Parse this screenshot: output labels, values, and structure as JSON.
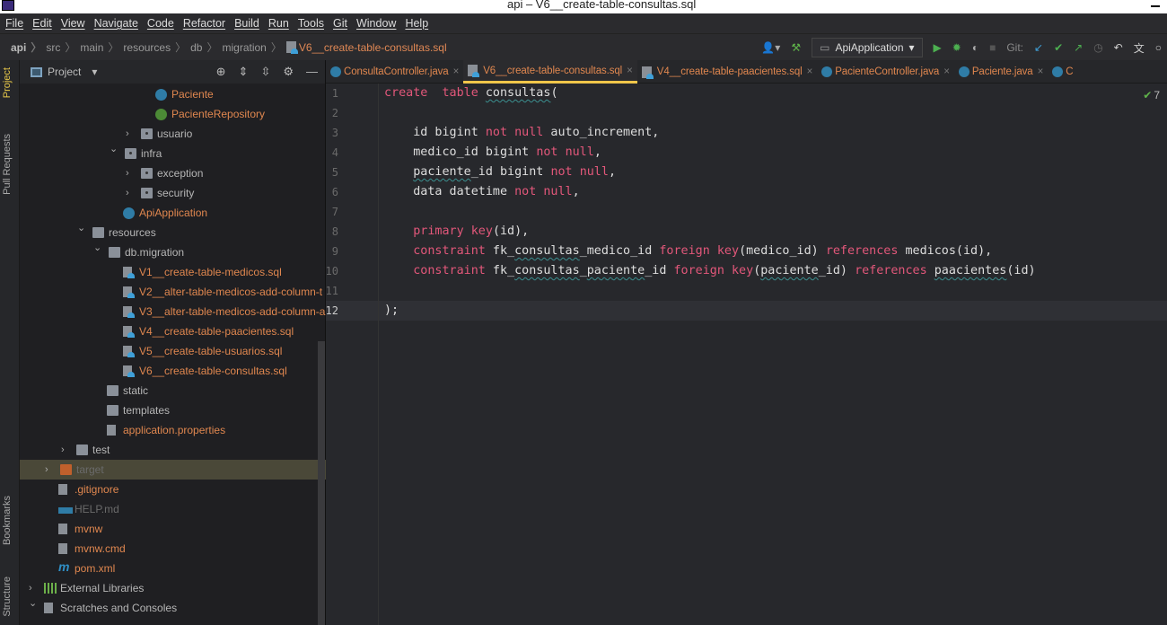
{
  "window": {
    "title": "api – V6__create-table-consultas.sql"
  },
  "menu": [
    "File",
    "Edit",
    "View",
    "Navigate",
    "Code",
    "Refactor",
    "Build",
    "Run",
    "Tools",
    "Git",
    "Window",
    "Help"
  ],
  "breadcrumb": [
    "api",
    "src",
    "main",
    "resources",
    "db",
    "migration",
    "V6__create-table-consultas.sql"
  ],
  "toolbar": {
    "run_config": "ApiApplication",
    "git_label": "Git:"
  },
  "left_stripe": {
    "project": "Project",
    "pull_requests": "Pull Requests",
    "bookmarks": "Bookmarks",
    "structure": "Structure"
  },
  "project_panel": {
    "title": "Project"
  },
  "tree": [
    {
      "label": "Paciente",
      "depth": 7,
      "icon": "class",
      "color": "o"
    },
    {
      "label": "PacienteRepository",
      "depth": 7,
      "icon": "iface",
      "color": "o"
    },
    {
      "label": "usuario",
      "depth": 6,
      "icon": "folder-pkg",
      "arrow": "collapsed",
      "color": "g"
    },
    {
      "label": "infra",
      "depth": 5,
      "icon": "folder-pkg",
      "arrow": "expanded",
      "color": "g"
    },
    {
      "label": "exception",
      "depth": 6,
      "icon": "folder-pkg",
      "arrow": "collapsed",
      "color": "g"
    },
    {
      "label": "security",
      "depth": 6,
      "icon": "folder-pkg",
      "arrow": "collapsed",
      "color": "g"
    },
    {
      "label": "ApiApplication",
      "depth": 5,
      "icon": "class",
      "color": "o"
    },
    {
      "label": "resources",
      "depth": 3,
      "icon": "folder",
      "arrow": "expanded",
      "color": "g"
    },
    {
      "label": "db.migration",
      "depth": 4,
      "icon": "folder",
      "arrow": "expanded",
      "color": "g"
    },
    {
      "label": "V1__create-table-medicos.sql",
      "depth": 5,
      "icon": "sql",
      "color": "o"
    },
    {
      "label": "V2__alter-table-medicos-add-column-t",
      "depth": 5,
      "icon": "sql",
      "color": "o"
    },
    {
      "label": "V3__alter-table-medicos-add-column-a",
      "depth": 5,
      "icon": "sql",
      "color": "o"
    },
    {
      "label": "V4__create-table-paacientes.sql",
      "depth": 5,
      "icon": "sql",
      "color": "o"
    },
    {
      "label": "V5__create-table-usuarios.sql",
      "depth": 5,
      "icon": "sql",
      "color": "o"
    },
    {
      "label": "V6__create-table-consultas.sql",
      "depth": 5,
      "icon": "sql",
      "color": "o"
    },
    {
      "label": "static",
      "depth": 4,
      "icon": "folder",
      "color": "g"
    },
    {
      "label": "templates",
      "depth": 4,
      "icon": "folder",
      "color": "g"
    },
    {
      "label": "application.properties",
      "depth": 4,
      "icon": "file",
      "color": "o"
    },
    {
      "label": "test",
      "depth": 2,
      "icon": "folder",
      "arrow": "collapsed",
      "color": "g"
    },
    {
      "label": "target",
      "depth": 1,
      "icon": "target",
      "arrow": "collapsed",
      "color": "dim",
      "selected": true
    },
    {
      "label": ".gitignore",
      "depth": 1,
      "icon": "file",
      "color": "o"
    },
    {
      "label": "HELP.md",
      "depth": 1,
      "icon": "md",
      "color": "dim"
    },
    {
      "label": "mvnw",
      "depth": 1,
      "icon": "file",
      "color": "o"
    },
    {
      "label": "mvnw.cmd",
      "depth": 1,
      "icon": "file",
      "color": "o"
    },
    {
      "label": "pom.xml",
      "depth": 1,
      "icon": "maven",
      "color": "o"
    },
    {
      "label": "External Libraries",
      "depth": 0,
      "icon": "lib",
      "arrow": "collapsed",
      "color": "g"
    },
    {
      "label": "Scratches and Consoles",
      "depth": 0,
      "icon": "file",
      "arrow": "expanded",
      "color": "g"
    }
  ],
  "tabs": [
    {
      "label": "ConsultaController.java",
      "icon": "class"
    },
    {
      "label": "V6__create-table-consultas.sql",
      "icon": "sql",
      "active": true
    },
    {
      "label": "V4__create-table-paacientes.sql",
      "icon": "sql"
    },
    {
      "label": "PacienteController.java",
      "icon": "class"
    },
    {
      "label": "Paciente.java",
      "icon": "class"
    },
    {
      "label": "C",
      "icon": "class"
    }
  ],
  "editor": {
    "inspection_count": "7",
    "current_line": 12,
    "lines": [
      [
        [
          "kw",
          "create"
        ],
        [
          "",
          "  "
        ],
        [
          "kw",
          "table"
        ],
        [
          "",
          " "
        ],
        [
          "wv",
          "consultas"
        ],
        [
          "",
          "("
        ]
      ],
      [],
      [
        [
          "",
          "    id bigint "
        ],
        [
          "kw",
          "not"
        ],
        [
          "",
          " "
        ],
        [
          "kw",
          "null"
        ],
        [
          "",
          " auto_increment,"
        ]
      ],
      [
        [
          "",
          "    medico_id bigint "
        ],
        [
          "kw",
          "not"
        ],
        [
          "",
          " "
        ],
        [
          "kw",
          "null"
        ],
        [
          "",
          ","
        ]
      ],
      [
        [
          "",
          "    "
        ],
        [
          "wv",
          "paciente"
        ],
        [
          "",
          "_id bigint "
        ],
        [
          "kw",
          "not"
        ],
        [
          "",
          " "
        ],
        [
          "kw",
          "null"
        ],
        [
          "",
          ","
        ]
      ],
      [
        [
          "",
          "    data datetime "
        ],
        [
          "kw",
          "not"
        ],
        [
          "",
          " "
        ],
        [
          "kw",
          "null"
        ],
        [
          "",
          ","
        ]
      ],
      [],
      [
        [
          "",
          "    "
        ],
        [
          "kw",
          "primary"
        ],
        [
          "",
          " "
        ],
        [
          "kw",
          "key"
        ],
        [
          "",
          "(id),"
        ]
      ],
      [
        [
          "",
          "    "
        ],
        [
          "kw",
          "constraint"
        ],
        [
          "",
          " fk_"
        ],
        [
          "wv",
          "consultas"
        ],
        [
          "",
          "_medico_id "
        ],
        [
          "kw",
          "foreign"
        ],
        [
          "",
          " "
        ],
        [
          "kw",
          "key"
        ],
        [
          "",
          "(medico_id) "
        ],
        [
          "kw",
          "references"
        ],
        [
          "",
          " medicos(id),"
        ]
      ],
      [
        [
          "",
          "    "
        ],
        [
          "kw",
          "constraint"
        ],
        [
          "",
          " fk_"
        ],
        [
          "wv",
          "consultas"
        ],
        [
          "",
          "_"
        ],
        [
          "wv",
          "paciente"
        ],
        [
          "",
          "_id "
        ],
        [
          "kw",
          "foreign"
        ],
        [
          "",
          " "
        ],
        [
          "kw",
          "key"
        ],
        [
          "",
          "("
        ],
        [
          "wv",
          "paciente"
        ],
        [
          "",
          "_id) "
        ],
        [
          "kw",
          "references"
        ],
        [
          "",
          " "
        ],
        [
          "wv",
          "paacientes"
        ],
        [
          "",
          "(id)"
        ]
      ],
      [],
      [
        [
          "",
          ");"
        ]
      ]
    ]
  }
}
